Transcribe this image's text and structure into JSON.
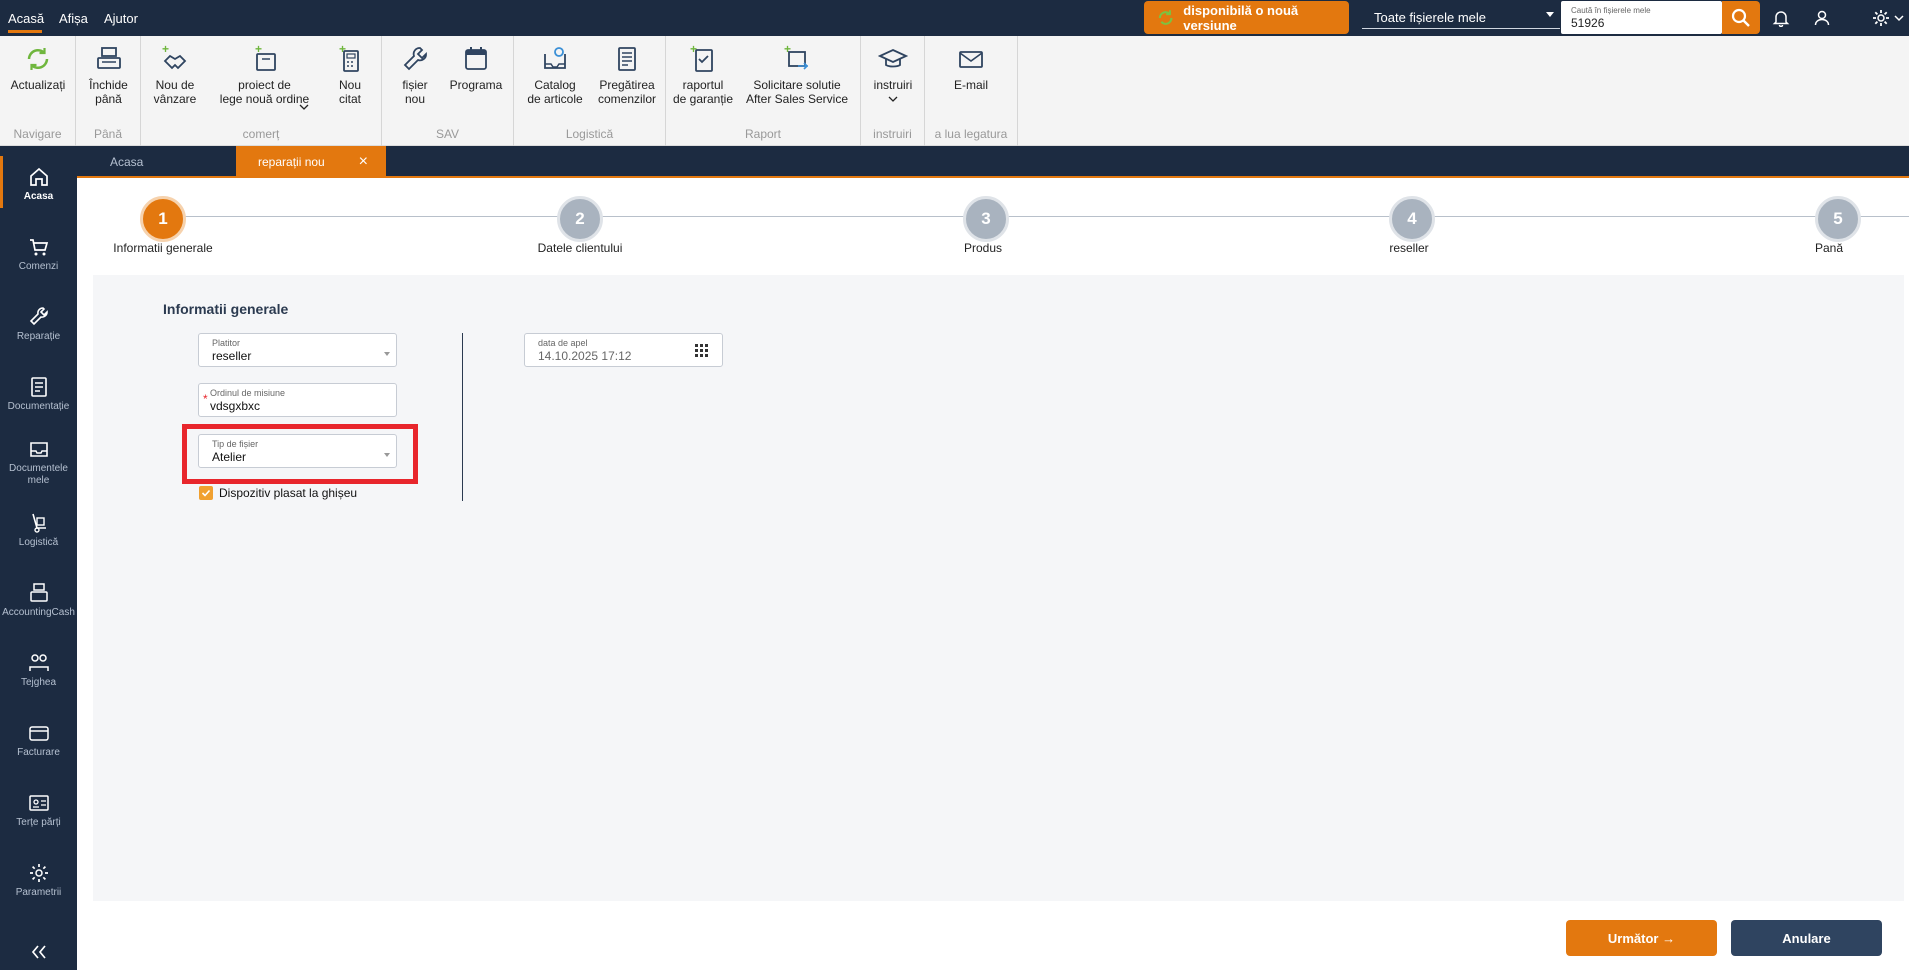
{
  "topbar": {
    "menu": [
      "Acasă",
      "Afișa",
      "Ajutor"
    ],
    "update_label": "disponibilă o nouă versiune",
    "scope_select": "Toate fișierele mele",
    "search_label": "Caută în fișierele mele",
    "search_value": "51926",
    "accent": "#e3780f"
  },
  "ribbon": {
    "groups": {
      "navigare": "Navigare",
      "pana": "Până",
      "comert": "comerț",
      "sav": "SAV",
      "logistica": "Logistică",
      "raport": "Raport",
      "instruiri": "instruiri",
      "legatura": "a lua legatura"
    },
    "buttons": {
      "actualizati": "Actualizați",
      "inchide": "Închide\npână",
      "nou_vanzare": "Nou de\nvânzare",
      "proiect": "proiect de\nlege nouă ordine",
      "nou_citat": "Nou\ncitat",
      "fisier_nou": "fișier\nnou",
      "programa": "Programa",
      "catalog": "Catalog\nde articole",
      "pregatirea": "Pregătirea\ncomenzilor",
      "raportul": "raportul\nde garanție",
      "solicitare": "Solicitare solutie\nAfter Sales Service",
      "instruiri": "instruiri",
      "email": "E-mail"
    }
  },
  "leftnav": {
    "items": [
      "Acasa",
      "Comenzi",
      "Reparație",
      "Documentație",
      "Documentele mele",
      "Logistică",
      "AccountingCash",
      "Tejghea",
      "Facturare",
      "Terțe părți",
      "Parametrii"
    ]
  },
  "tabs": {
    "home": "Acasa",
    "repair": "reparații nou"
  },
  "steps": [
    {
      "num": "1",
      "label": "Informatii generale"
    },
    {
      "num": "2",
      "label": "Datele clientului"
    },
    {
      "num": "3",
      "label": "Produs"
    },
    {
      "num": "4",
      "label": "reseller"
    },
    {
      "num": "5",
      "label": "Pană"
    }
  ],
  "form": {
    "title": "Informatii generale",
    "platitor": {
      "label": "Platitor",
      "value": "reseller"
    },
    "ordin": {
      "label": "Ordinul de misiune",
      "value": "vdsgxbxc"
    },
    "tip": {
      "label": "Tip de fișier",
      "value": "Atelier"
    },
    "checkbox_label": "Dispozitiv plasat la ghișeu",
    "data_apel": {
      "label": "data de apel",
      "value": "14.10.2025 17:12"
    }
  },
  "actions": {
    "next": "Următor →",
    "cancel": "Anulare"
  }
}
